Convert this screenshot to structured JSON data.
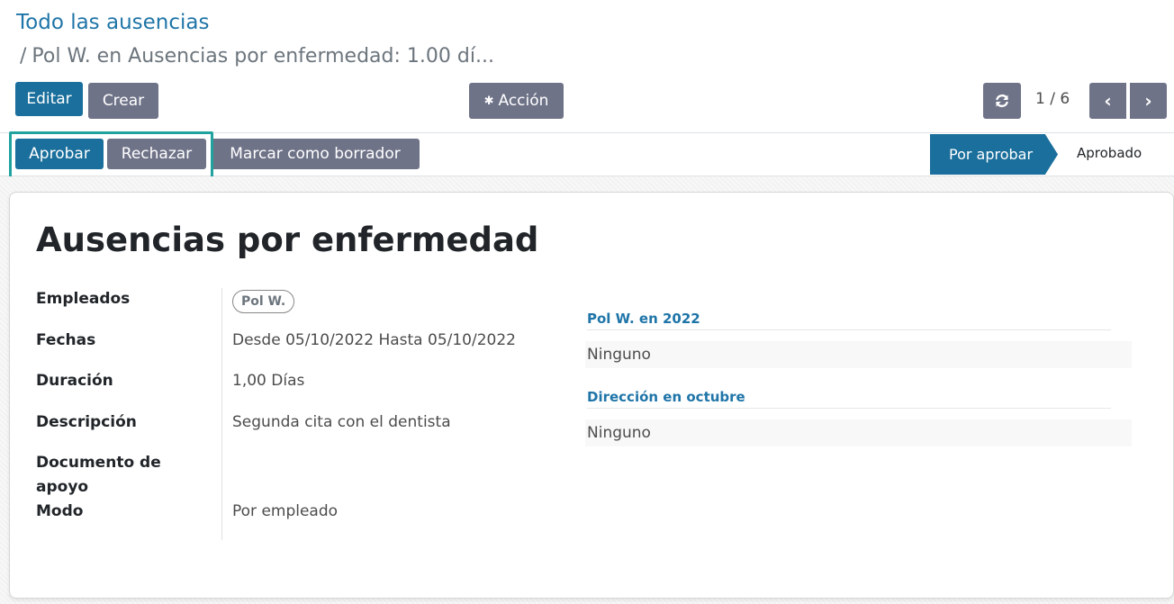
{
  "breadcrumb": {
    "parent": "Todo las ausencias",
    "separator": "/",
    "current": "Pol W. en Ausencias por enfermedad: 1.00 dí..."
  },
  "toolbar": {
    "edit_label": "Editar",
    "create_label": "Crear",
    "action_label": "Acción",
    "action_icon": "gear-icon",
    "refresh_icon": "refresh-icon"
  },
  "pager": {
    "value": "1 / 6",
    "prev_icon": "chevron-left-icon",
    "next_icon": "chevron-right-icon"
  },
  "statusbar": {
    "approve_label": "Aprobar",
    "refuse_label": "Rechazar",
    "draft_label": "Marcar como borrador",
    "stages": [
      "Por aprobar",
      "Aprobado"
    ],
    "active_stage": "Por aprobar",
    "highlight_color": "#20a39e"
  },
  "form": {
    "title": "Ausencias por enfermedad",
    "fields": {
      "employees_label": "Empleados",
      "employees_tag": "Pol W.",
      "dates_label": "Fechas",
      "dates_from": "Desde",
      "date_from_value": "05/10/2022",
      "dates_to": "Hasta",
      "date_to_value": "05/10/2022",
      "duration_label": "Duración",
      "duration_value": "1,00",
      "duration_unit": "Días",
      "description_label": "Descripción",
      "description_value": "Segunda cita con el dentista",
      "support_doc_label": "Documento de apoyo",
      "mode_label": "Modo",
      "mode_value": "Por empleado"
    }
  },
  "allocations": [
    {
      "title": "Pol W. en 2022",
      "value": "Ninguno"
    },
    {
      "title": "Dirección en octubre",
      "value": "Ninguno"
    }
  ],
  "colors": {
    "primary": "#1b6f9c",
    "secondary": "#6f7388",
    "link": "#1f75a8"
  }
}
